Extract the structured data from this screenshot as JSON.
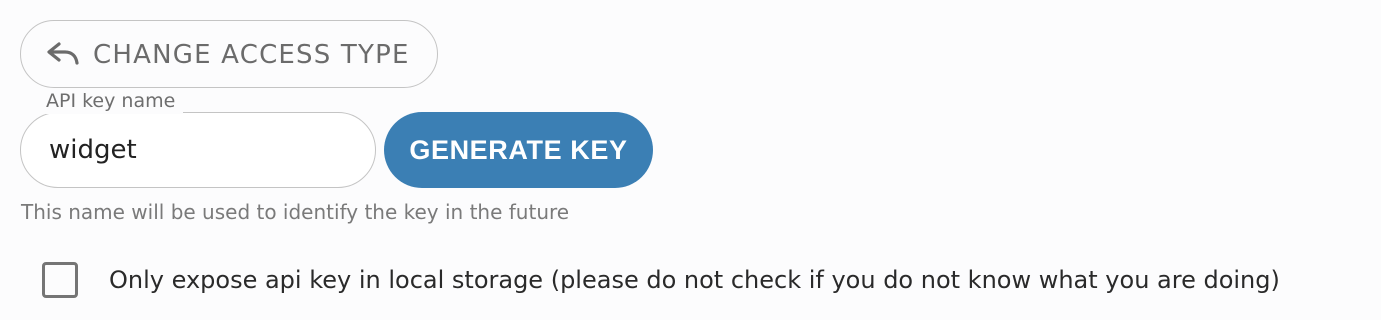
{
  "access_type_button": {
    "label": "CHANGE ACCESS TYPE",
    "icon": "undo-icon"
  },
  "api_key_field": {
    "label": "API key name",
    "value": "widget",
    "helper_text": "This name will be used to identify the key in the future"
  },
  "generate_button": {
    "label": "GENERATE KEY"
  },
  "local_storage_option": {
    "label": "Only expose api key in local storage (please do not check if you do not know what you are doing)",
    "checked": false
  },
  "colors": {
    "primary": "#3b7fb4",
    "outline": "#c4c4c4",
    "muted_text": "#6b6b6b"
  }
}
